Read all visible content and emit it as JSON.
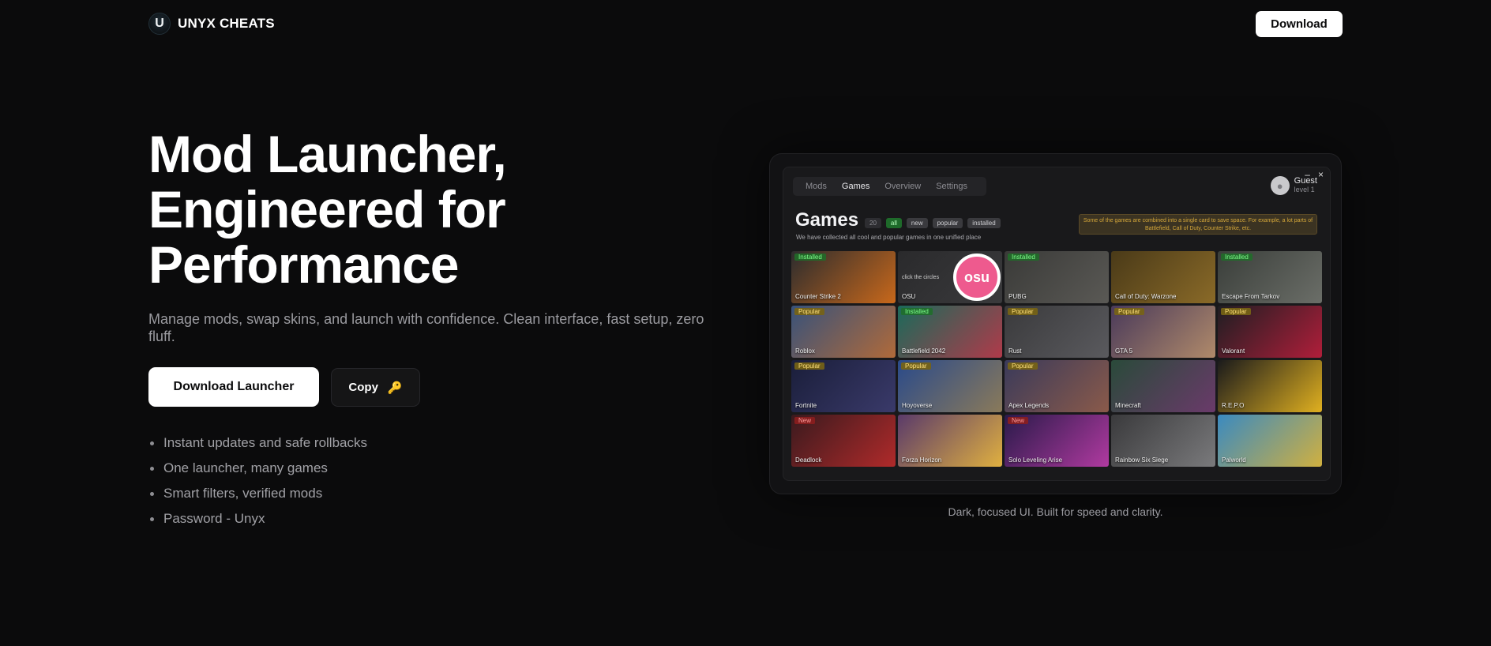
{
  "header": {
    "logo_letter": "U",
    "brand_name": "UNYX CHEATS",
    "download_label": "Download"
  },
  "hero": {
    "title_lines": [
      "Mod Launcher,",
      "Engineered for",
      "Performance"
    ],
    "subtitle": "Manage mods, swap skins, and launch with confidence. Clean interface, fast setup, zero fluff.",
    "primary_button": "Download Launcher",
    "copy_button": "Copy",
    "copy_icon": "key-icon",
    "features": [
      "Instant updates and safe rollbacks",
      "One launcher, many games",
      "Smart filters, verified mods",
      "Password - Unyx"
    ]
  },
  "preview": {
    "window_controls": [
      "–",
      "×"
    ],
    "tabs": [
      "Mods",
      "Games",
      "Overview",
      "Settings"
    ],
    "active_tab": "Games",
    "user": {
      "name": "Guest",
      "level": "level 1"
    },
    "title": "Games",
    "count": "20",
    "filters": [
      "all",
      "new",
      "popular",
      "installed"
    ],
    "subtitle": "We have collected all cool and popular games in one unified place",
    "notice": "Some of the games are combined into a single card to save space. For example, a lot parts of Battlefield, Call of Duty, Counter Strike, etc.",
    "games": [
      {
        "name": "Counter Strike 2",
        "badge": "Installed",
        "colors": [
          "#2c2c2e",
          "#c8681b"
        ]
      },
      {
        "name": "OSU",
        "badge": "",
        "hint": "click the circles",
        "colors": [
          "#2a2a2c",
          "#3a3a3c"
        ]
      },
      {
        "name": "PUBG",
        "badge": "Installed",
        "colors": [
          "#3a3a38",
          "#5a5955"
        ]
      },
      {
        "name": "Call of Duty: Warzone",
        "badge": "",
        "colors": [
          "#4a3a18",
          "#8a6a28"
        ]
      },
      {
        "name": "Escape From Tarkov",
        "badge": "Installed",
        "colors": [
          "#3a3e3a",
          "#6b6e68"
        ]
      },
      {
        "name": "Roblox",
        "badge": "Popular",
        "colors": [
          "#38527a",
          "#b06a3a"
        ]
      },
      {
        "name": "Battlefield 2042",
        "badge": "Installed",
        "colors": [
          "#1a6a5a",
          "#b03a4a"
        ]
      },
      {
        "name": "Rust",
        "badge": "Popular",
        "colors": [
          "#3a3a3c",
          "#5a5a5e"
        ]
      },
      {
        "name": "GTA 5",
        "badge": "Popular",
        "colors": [
          "#4a3a5a",
          "#b08a6a"
        ]
      },
      {
        "name": "Valorant",
        "badge": "Popular",
        "colors": [
          "#1e1e22",
          "#b01e3a"
        ]
      },
      {
        "name": "Fortnite",
        "badge": "Popular",
        "colors": [
          "#1a1e3a",
          "#3a3a6a"
        ]
      },
      {
        "name": "Hoyoverse",
        "badge": "Popular",
        "colors": [
          "#2a4a8a",
          "#8a7a5a"
        ]
      },
      {
        "name": "Apex Legends",
        "badge": "Popular",
        "colors": [
          "#3a3a5a",
          "#8a5a4a"
        ]
      },
      {
        "name": "Minecraft",
        "badge": "",
        "colors": [
          "#2a4a3a",
          "#6a3a6a"
        ]
      },
      {
        "name": "R.E.P.O",
        "badge": "",
        "colors": [
          "#1a1a1c",
          "#e0b020"
        ]
      },
      {
        "name": "Deadlock",
        "badge": "New",
        "colors": [
          "#3a1a1e",
          "#b02a2a"
        ]
      },
      {
        "name": "Forza Horizon",
        "badge": "",
        "colors": [
          "#5a3a6a",
          "#e0b040"
        ]
      },
      {
        "name": "Solo Leveling Arise",
        "badge": "New",
        "colors": [
          "#2a1a4a",
          "#b03aa0"
        ]
      },
      {
        "name": "Rainbow Six Siege",
        "badge": "",
        "colors": [
          "#3a3a3c",
          "#7a7a7c"
        ]
      },
      {
        "name": "Palworld",
        "badge": "",
        "colors": [
          "#3a8ac0",
          "#d0b040"
        ]
      }
    ],
    "caption": "Dark, focused UI. Built for speed and clarity."
  }
}
